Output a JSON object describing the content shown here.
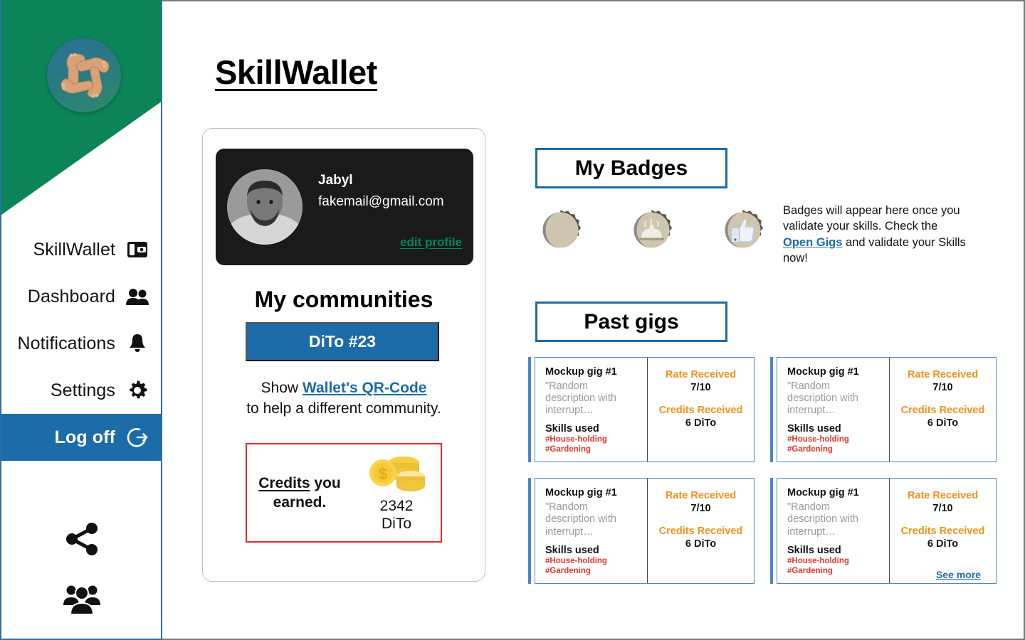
{
  "app": {
    "title": "SkillWallet"
  },
  "sidebar": {
    "logo_icon": "hands-square-logo-icon",
    "items": [
      {
        "label": "SkillWallet",
        "icon": "wallet-icon",
        "active": false
      },
      {
        "label": "Dashboard",
        "icon": "people-icon",
        "active": false
      },
      {
        "label": "Notifications",
        "icon": "bell-icon",
        "active": false
      },
      {
        "label": "Settings",
        "icon": "gear-icon",
        "active": false
      },
      {
        "label": "Log off",
        "icon": "logout-arrow-icon",
        "active": true
      }
    ],
    "bottom_icons": [
      {
        "name": "share-icon"
      },
      {
        "name": "community-group-icon"
      }
    ]
  },
  "profile": {
    "avatar_icon": "user-photo-avatar",
    "name": "Jabyl",
    "email": "fakemail@gmail.com",
    "edit_link": "edit profile",
    "communities_title": "My communities",
    "community_button": "DiTo #23",
    "qr_prefix": "Show ",
    "qr_link": "Wallet's QR-Code",
    "qr_suffix": "to help a different community.",
    "credits_label_underlined": "Credits",
    "credits_label_rest": " you earned.",
    "credits_icon": "gold-coins-icon",
    "credits_amount": "2342",
    "credits_currency": "DiTo"
  },
  "badges": {
    "heading": "My Badges",
    "items": [
      {
        "icon": "blank-badge-icon"
      },
      {
        "icon": "food-cloche-badge-icon"
      },
      {
        "icon": "thumbs-up-badge-icon"
      }
    ],
    "note_part1": "Badges will appear here once you validate your skills. Check the ",
    "note_link": "Open Gigs",
    "note_part2": " and validate your Skills now!"
  },
  "past_gigs": {
    "heading": "Past gigs",
    "see_more": "See more",
    "cards": [
      {
        "title": "Mockup gig #1",
        "description": "\"Random description with interrupt…",
        "skills_label": "Skills used",
        "tags": [
          "#House-holding",
          "#Gardening"
        ],
        "rate_label": "Rate Received",
        "rate_value": "7/10",
        "credits_label": "Credits Received",
        "credits_value": "6 DiTo"
      },
      {
        "title": "Mockup gig #1",
        "description": "\"Random description with interrupt…",
        "skills_label": "Skills used",
        "tags": [
          "#House-holding",
          "#Gardening"
        ],
        "rate_label": "Rate Received",
        "rate_value": "7/10",
        "credits_label": "Credits Received",
        "credits_value": "6 DiTo"
      },
      {
        "title": "Mockup gig #1",
        "description": "\"Random description with interrupt…",
        "skills_label": "Skills used",
        "tags": [
          "#House-holding",
          "#Gardening"
        ],
        "rate_label": "Rate Received",
        "rate_value": "7/10",
        "credits_label": "Credits Received",
        "credits_value": "6 DiTo"
      },
      {
        "title": "Mockup gig #1",
        "description": "\"Random description with interrupt…",
        "skills_label": "Skills used",
        "tags": [
          "#House-holding",
          "#Gardening"
        ],
        "rate_label": "Rate Received",
        "rate_value": "7/10",
        "credits_label": "Credits Received",
        "credits_value": "6 DiTo"
      }
    ]
  },
  "colors": {
    "brand_green": "#0b8457",
    "accent_blue": "#1b6ca8",
    "card_blue": "#4a88c7",
    "orange": "#f0921e",
    "tag_red": "#e0392e",
    "credits_border_red": "#e32b26",
    "dark_card": "#1a1a1a"
  }
}
